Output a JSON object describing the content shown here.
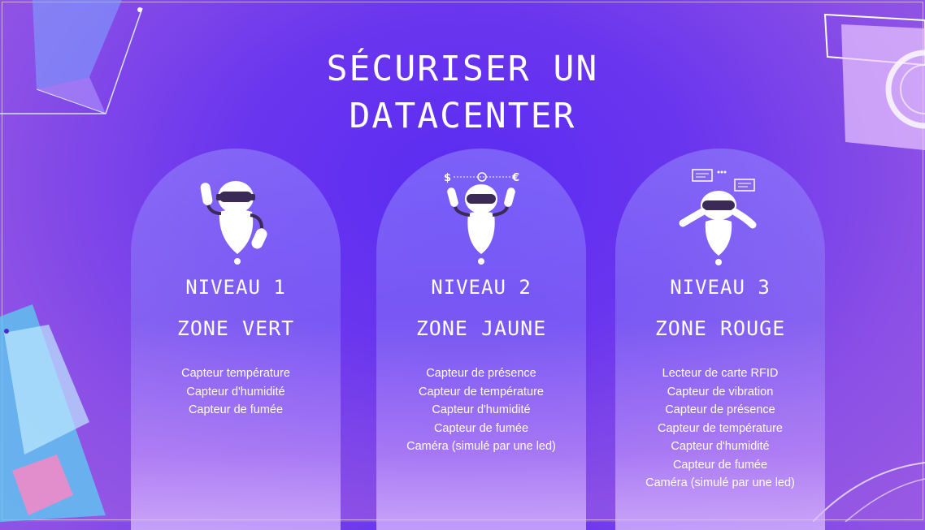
{
  "title_line1": "SÉCURISER UN",
  "title_line2": "DATACENTER",
  "cards": [
    {
      "level": "NIVEAU 1",
      "zone": "ZONE VERT",
      "items": [
        "Capteur température",
        "Capteur d'humidité",
        "Capteur de fumée"
      ]
    },
    {
      "level": "NIVEAU 2",
      "zone": "ZONE JAUNE",
      "items": [
        "Capteur de présence",
        "Capteur de température",
        "Capteur d'humidité",
        "Capteur de fumée",
        "Caméra (simulé par une led)"
      ]
    },
    {
      "level": "NIVEAU 3",
      "zone": "ZONE ROUGE",
      "items": [
        "Lecteur de carte RFID",
        "Capteur de vibration",
        "Capteur de présence",
        "Capteur de température",
        "Capteur d'humidité",
        "Capteur de fumée",
        "Caméra (simulé par une led)"
      ]
    }
  ],
  "robot2_symbols": {
    "left": "$",
    "right": "€"
  },
  "colors": {
    "accent": "#5a2cf2",
    "robot_visor": "#3a2a55"
  }
}
